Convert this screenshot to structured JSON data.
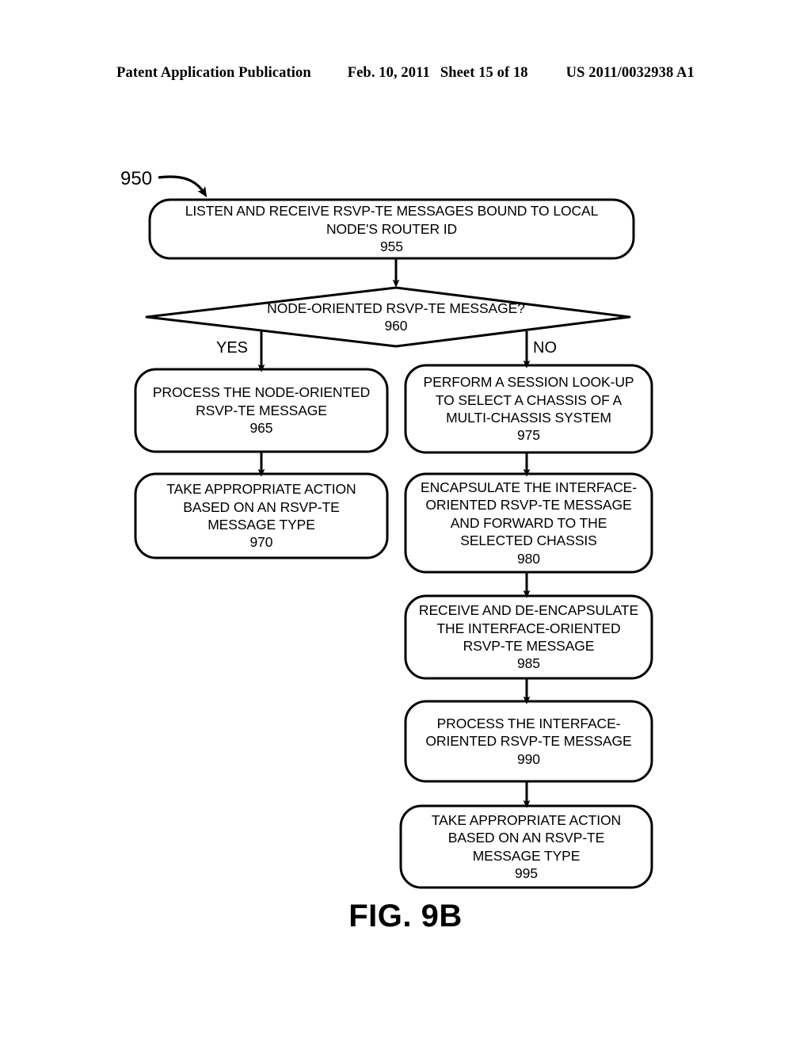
{
  "header": {
    "publication": "Patent Application Publication",
    "date": "Feb. 10, 2011",
    "sheet": "Sheet 15 of 18",
    "publication_number": "US 2011/0032938 A1"
  },
  "figure": {
    "caption": "FIG. 9B",
    "flow_label": "950",
    "branch_yes": "YES",
    "branch_no": "NO"
  },
  "nodes": {
    "n955": {
      "ref": "955",
      "shape": "rounded-rectangle",
      "lines": [
        "LISTEN AND RECEIVE RSVP-TE MESSAGES BOUND TO LOCAL",
        "NODE'S ROUTER ID"
      ]
    },
    "n960": {
      "ref": "960",
      "shape": "diamond",
      "lines": [
        "NODE-ORIENTED RSVP-TE MESSAGE?"
      ]
    },
    "n965": {
      "ref": "965",
      "shape": "rounded-rectangle",
      "lines": [
        "PROCESS THE NODE-ORIENTED",
        "RSVP-TE MESSAGE"
      ]
    },
    "n970": {
      "ref": "970",
      "shape": "rounded-rectangle",
      "lines": [
        "TAKE APPROPRIATE ACTION",
        "BASED ON AN RSVP-TE",
        "MESSAGE TYPE"
      ]
    },
    "n975": {
      "ref": "975",
      "shape": "rounded-rectangle",
      "lines": [
        "PERFORM A SESSION LOOK-UP",
        "TO SELECT A CHASSIS OF A",
        "MULTI-CHASSIS SYSTEM"
      ]
    },
    "n980": {
      "ref": "980",
      "shape": "rounded-rectangle",
      "lines": [
        "ENCAPSULATE THE INTERFACE-",
        "ORIENTED RSVP-TE MESSAGE",
        "AND FORWARD TO THE",
        "SELECTED CHASSIS"
      ]
    },
    "n985": {
      "ref": "985",
      "shape": "rounded-rectangle",
      "lines": [
        "RECEIVE AND DE-ENCAPSULATE",
        "THE INTERFACE-ORIENTED",
        "RSVP-TE MESSAGE"
      ]
    },
    "n990": {
      "ref": "990",
      "shape": "rounded-rectangle",
      "lines": [
        "PROCESS THE INTERFACE-",
        "ORIENTED RSVP-TE MESSAGE"
      ]
    },
    "n995": {
      "ref": "995",
      "shape": "rounded-rectangle",
      "lines": [
        "TAKE APPROPRIATE ACTION",
        "BASED ON AN RSVP-TE",
        "MESSAGE TYPE"
      ]
    }
  },
  "colors": {
    "ink": "#000000",
    "paper": "#ffffff"
  }
}
